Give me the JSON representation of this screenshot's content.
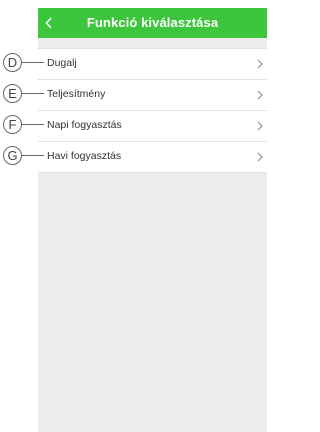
{
  "header": {
    "title": "Funkció kiválasztása",
    "background": "#3dc63d",
    "back_icon": "chevron-left-icon"
  },
  "items": [
    {
      "marker": "D",
      "label": "Dugalj"
    },
    {
      "marker": "E",
      "label": "Teljesítmény"
    },
    {
      "marker": "F",
      "label": "Napi fogyasztás"
    },
    {
      "marker": "G",
      "label": "Havi fogyasztás"
    }
  ],
  "item_icon": "chevron-right-icon"
}
